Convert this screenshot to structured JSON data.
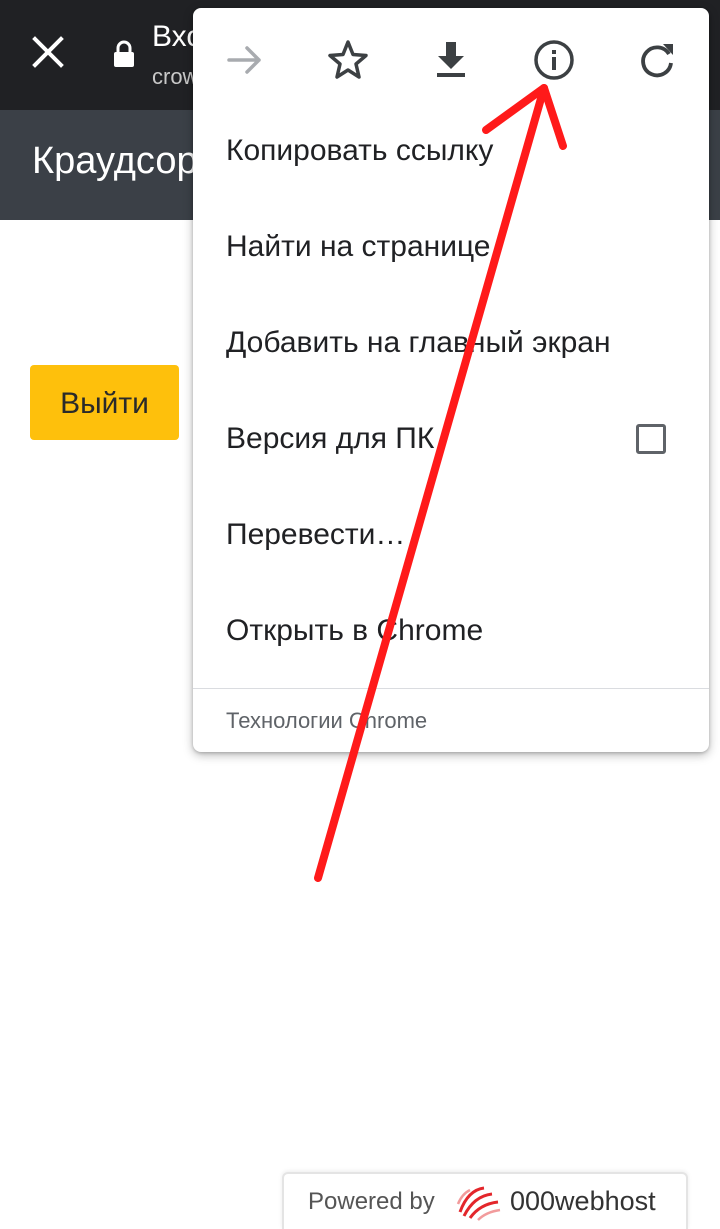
{
  "tab": {
    "title": "Вход",
    "url": "crowdsource"
  },
  "site": {
    "title": "Краудсорсинг"
  },
  "page": {
    "logout_label": "Выйти"
  },
  "menu": {
    "icons": [
      "forward-arrow-icon",
      "star-icon",
      "download-icon",
      "info-icon",
      "refresh-icon"
    ],
    "items": [
      {
        "label": "Копировать ссылку"
      },
      {
        "label": "Найти на странице"
      },
      {
        "label": "Добавить на главный экран"
      },
      {
        "label": "Версия для ПК",
        "checkbox": false
      },
      {
        "label": "Перевести…"
      },
      {
        "label": "Открыть в Chrome"
      }
    ],
    "footer": "Технологии Chrome"
  },
  "badge": {
    "powered_by": "Powered by",
    "brand": "000webhost"
  },
  "colors": {
    "topbar": "#202124",
    "site_header": "#3b4047",
    "logout_button": "#fec00c",
    "annotation": "#ff1a1a"
  }
}
